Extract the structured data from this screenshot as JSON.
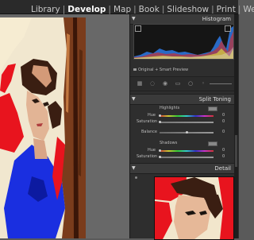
{
  "modules": [
    "Library",
    "Develop",
    "Map",
    "Book",
    "Slideshow",
    "Print",
    "We"
  ],
  "active_module": "Develop",
  "histogram": {
    "title": "Histogram",
    "caption": "Original + Smart Preview"
  },
  "split_toning": {
    "title": "Split Toning",
    "highlights": {
      "label": "Highlights",
      "hue_label": "Hue",
      "hue_value": "0",
      "saturation_label": "Saturation",
      "saturation_value": "0"
    },
    "balance": {
      "label": "Balance",
      "value": "0"
    },
    "shadows": {
      "label": "Shadows",
      "hue_label": "Hue",
      "hue_value": "0",
      "saturation_label": "Saturation",
      "saturation_value": "0"
    }
  },
  "detail": {
    "title": "Detail"
  },
  "colors": {
    "accent_red": "#e8141e",
    "accent_blue": "#1a2fe0",
    "panel_bg": "#2e2e2e"
  }
}
